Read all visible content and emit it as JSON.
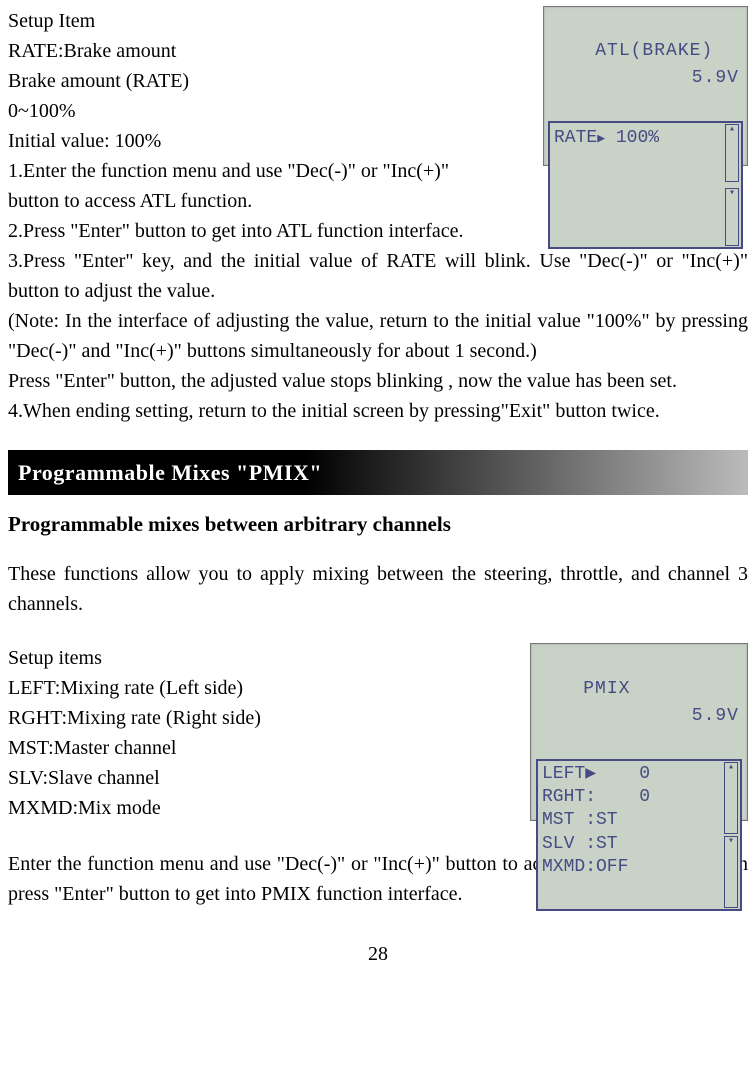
{
  "atl": {
    "lcd": {
      "title_left": "ATL(BRAKE)",
      "title_right": "5.9V",
      "line1_label": "RATE",
      "line1_value": "100%"
    },
    "lines": [
      "Setup Item",
      "RATE:Brake amount",
      "Brake amount (RATE)",
      "0~100%",
      "Initial value: 100%"
    ],
    "p1a": "1.Enter the function menu and use  \"Dec(-)\" or \"Inc(+)\"",
    "p1b": "button to access ATL function.",
    "p2": "2.Press \"Enter\" button to get into ATL function interface.",
    "p3": "3.Press \"Enter\" key, and the initial value of RATE will blink. Use \"Dec(-)\" or \"Inc(+)\" button to adjust the value.",
    "note": "(Note: In the interface of adjusting the value, return to the initial value \"100%\" by pressing \"Dec(-)\" and \"Inc(+)\" buttons simultaneously for about 1 second.)",
    "p3b": "Press  \"Enter\" button, the adjusted value stops blinking , now the value has been set.",
    "p4": "4.When ending setting, return to the initial screen by pressing\"Exit\" button twice."
  },
  "banner": "Programmable Mixes   \"PMIX\"",
  "pmix": {
    "subheading": "Programmable mixes between arbitrary channels",
    "intro": "These functions allow you to apply mixing between the steering, throttle, and channel 3 channels.",
    "setup_label": "Setup items",
    "items": [
      "LEFT:Mixing rate (Left side)",
      "RGHT:Mixing rate (Right side)",
      "MST:Master channel",
      "SLV:Slave channel",
      "MXMD:Mix mode"
    ],
    "lcd": {
      "title_left": "PMIX",
      "title_right": "5.9V",
      "rows": [
        "LEFT▶    0",
        "RGHT:    0",
        "MST :ST",
        "SLV :ST",
        "MXMD:OFF"
      ]
    },
    "instr": "Enter the function menu and use  \"Dec(-)\" or \"Inc(+)\" button to access PMIX function, then press \"Enter\" button to get into PMIX function interface."
  },
  "page_number": "28"
}
